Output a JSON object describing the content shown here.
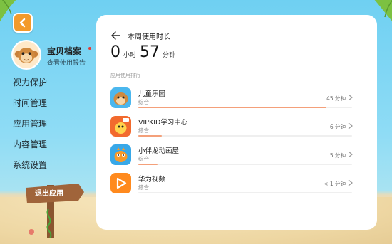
{
  "nav": {
    "back_icon": "back-arrow-icon"
  },
  "profile": {
    "name": "宝贝档案",
    "subtitle": "查看使用报告",
    "notification_dot_color": "#e53935"
  },
  "menu": [
    {
      "label": "视力保护"
    },
    {
      "label": "时间管理"
    },
    {
      "label": "应用管理"
    },
    {
      "label": "内容管理"
    },
    {
      "label": "系统设置"
    }
  ],
  "exit": {
    "label": "退出应用"
  },
  "panel": {
    "title": "本周使用时长",
    "total": {
      "hours": "0",
      "hours_unit": "小时",
      "minutes": "57",
      "minutes_unit": "分钟"
    },
    "section_label": "应用使用排行",
    "apps": [
      {
        "name": "儿童乐园",
        "category": "综合",
        "time": "45 分钟",
        "share": 0.88,
        "icon": "monkey-app-icon"
      },
      {
        "name": "VIPKID学习中心",
        "category": "综合",
        "time": "6 分钟",
        "share": 0.11,
        "icon": "vipkid-app-icon"
      },
      {
        "name": "小伴龙动画屋",
        "category": "综合",
        "time": "5 分钟",
        "share": 0.09,
        "icon": "dragon-app-icon"
      },
      {
        "name": "华为视频",
        "category": "综合",
        "time": "< 1 分钟",
        "share": 0.0,
        "icon": "video-app-icon"
      }
    ]
  },
  "colors": {
    "accent_orange": "#f39a2a",
    "bar_fill": "#f4a07a"
  }
}
